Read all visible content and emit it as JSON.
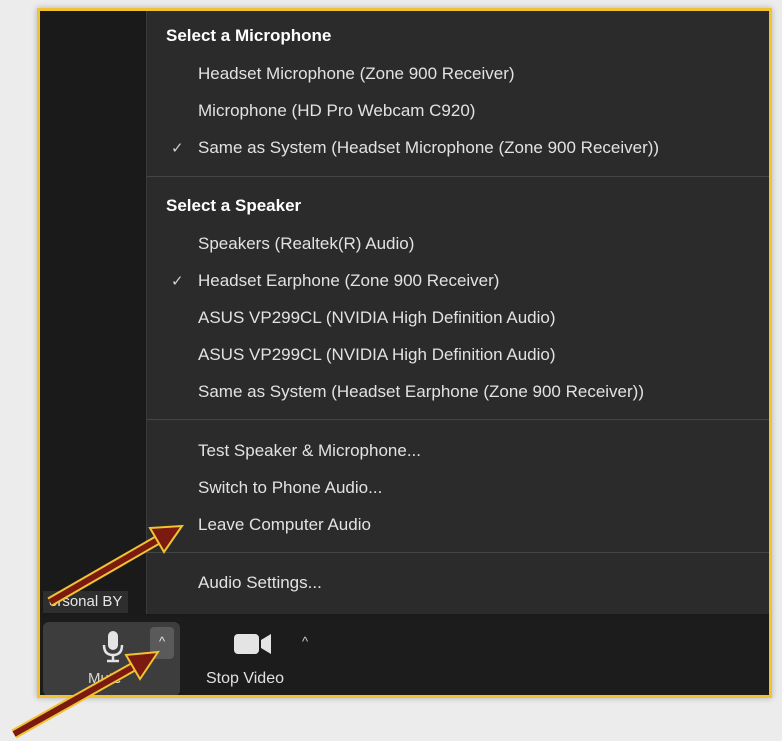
{
  "video": {
    "name_tag": "ersonal BY"
  },
  "menu": {
    "mic_section": {
      "title": "Select a Microphone",
      "items": [
        {
          "label": "Headset Microphone (Zone 900 Receiver)",
          "checked": false
        },
        {
          "label": "Microphone (HD Pro Webcam C920)",
          "checked": false
        },
        {
          "label": "Same as System (Headset Microphone (Zone 900 Receiver))",
          "checked": true
        }
      ]
    },
    "speaker_section": {
      "title": "Select a Speaker",
      "items": [
        {
          "label": "Speakers (Realtek(R) Audio)",
          "checked": false
        },
        {
          "label": "Headset Earphone (Zone 900 Receiver)",
          "checked": true
        },
        {
          "label": "ASUS VP299CL (NVIDIA High Definition Audio)",
          "checked": false
        },
        {
          "label": "ASUS VP299CL (NVIDIA High Definition Audio)",
          "checked": false
        },
        {
          "label": "Same as System (Headset Earphone (Zone 900 Receiver))",
          "checked": false
        }
      ]
    },
    "actions": [
      "Test Speaker & Microphone...",
      "Switch to Phone Audio...",
      "Leave Computer Audio"
    ],
    "settings": "Audio Settings...",
    "check_glyph": "✓"
  },
  "toolbar": {
    "mute_label": "Mute",
    "caret_glyph": "^",
    "video_label": "Stop Video"
  },
  "colors": {
    "highlight_border": "#f2c230",
    "annotation_arrow": "#7a1a10"
  }
}
